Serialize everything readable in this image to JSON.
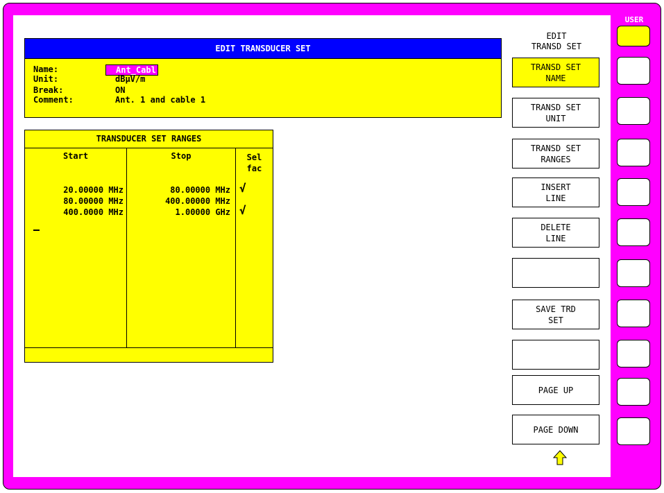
{
  "editor": {
    "title": "EDIT TRANSDUCER SET",
    "fields": [
      {
        "label": "Name:",
        "value": "Ant_Cabl"
      },
      {
        "label": "Unit:",
        "value": "dBµV/m"
      },
      {
        "label": "Break:",
        "value": "ON"
      },
      {
        "label": "Comment:",
        "value": "Ant. 1 and cable 1"
      }
    ]
  },
  "ranges": {
    "title": "TRANSDUCER SET RANGES",
    "headers": {
      "start": "Start",
      "stop": "Stop",
      "sel_line1": "Sel",
      "sel_line2": "fac"
    },
    "rows": [
      {
        "start": "20.00000 MHz",
        "stop": "80.00000 MHz",
        "selected": true
      },
      {
        "start": "80.00000 MHz",
        "stop": "400.00000 MHz",
        "selected": false
      },
      {
        "start": "400.0000 MHz",
        "stop": "1.00000 GHz",
        "selected": true
      }
    ],
    "check_glyph": "√"
  },
  "softkeys": {
    "menu_title": "EDIT\nTRANSD SET",
    "buttons": [
      {
        "label": "TRANSD SET\nNAME",
        "active": true
      },
      {
        "label": "TRANSD SET\nUNIT",
        "active": false
      },
      {
        "label": "TRANSD SET\nRANGES",
        "active": false
      },
      {
        "label": "INSERT\nLINE",
        "active": false
      },
      {
        "label": "DELETE\nLINE",
        "active": false
      },
      {
        "label": "",
        "active": false
      },
      {
        "label": "SAVE TRD\nSET",
        "active": false
      },
      {
        "label": "",
        "active": false
      },
      {
        "label": "PAGE UP",
        "active": false
      },
      {
        "label": "PAGE DOWN",
        "active": false
      }
    ]
  },
  "hardkeys": {
    "user_label": "USER"
  },
  "colors": {
    "frame": "#ff00ff",
    "header": "#0000ff",
    "panel": "#ffff00"
  }
}
